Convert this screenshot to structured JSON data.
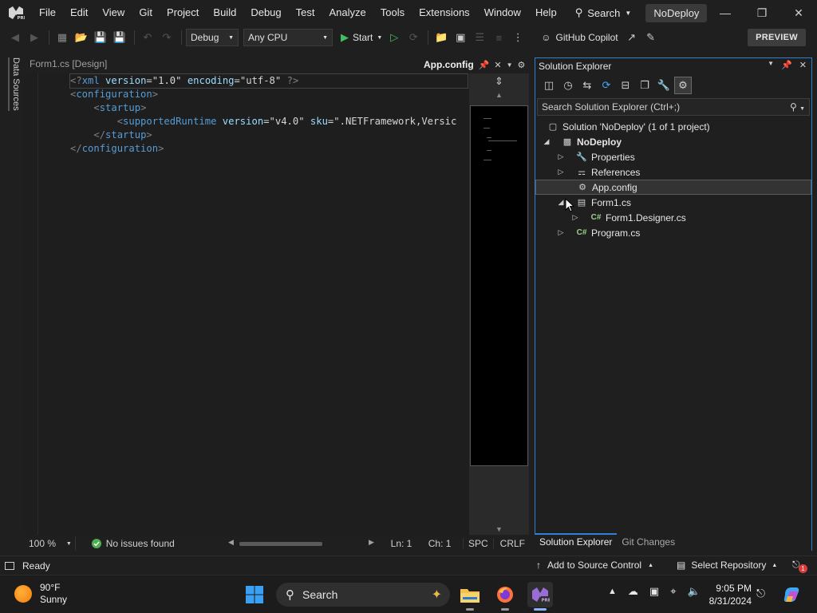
{
  "menubar": {
    "items": [
      "File",
      "Edit",
      "View",
      "Git",
      "Project",
      "Build",
      "Debug",
      "Test",
      "Analyze",
      "Tools",
      "Extensions",
      "Window",
      "Help"
    ],
    "search_label": "Search",
    "solution_badge": "NoDeploy"
  },
  "toolbar": {
    "config": "Debug",
    "platform": "Any CPU",
    "start_label": "Start",
    "copilot_label": "GitHub Copilot",
    "preview_label": "PREVIEW"
  },
  "left_strip": {
    "data_sources": "Data Sources"
  },
  "editor": {
    "tabs": {
      "design_tab": "Form1.cs [Design]",
      "active_tab": "App.config"
    },
    "code_lines": [
      {
        "parts": [
          [
            "punct",
            "<?"
          ],
          [
            "tag",
            "xml"
          ],
          [
            "sp",
            " "
          ],
          [
            "attr",
            "version"
          ],
          [
            "eq",
            "="
          ],
          [
            "q",
            "\""
          ],
          [
            "val",
            "1.0"
          ],
          [
            "q",
            "\""
          ],
          [
            "sp",
            " "
          ],
          [
            "attr",
            "encoding"
          ],
          [
            "eq",
            "="
          ],
          [
            "q",
            "\""
          ],
          [
            "val",
            "utf-8"
          ],
          [
            "q",
            "\""
          ],
          [
            "sp",
            " "
          ],
          [
            "punct",
            "?>"
          ]
        ]
      },
      {
        "parts": [
          [
            "punct",
            "<"
          ],
          [
            "tag",
            "configuration"
          ],
          [
            "punct",
            ">"
          ]
        ]
      },
      {
        "parts": [
          [
            "sp",
            "    "
          ],
          [
            "punct",
            "<"
          ],
          [
            "tag",
            "startup"
          ],
          [
            "punct",
            ">"
          ]
        ]
      },
      {
        "parts": [
          [
            "sp",
            "        "
          ],
          [
            "punct",
            "<"
          ],
          [
            "tag",
            "supportedRuntime"
          ],
          [
            "sp",
            " "
          ],
          [
            "attr",
            "version"
          ],
          [
            "eq",
            "="
          ],
          [
            "q",
            "\""
          ],
          [
            "val",
            "v4.0"
          ],
          [
            "q",
            "\""
          ],
          [
            "sp",
            " "
          ],
          [
            "attr",
            "sku"
          ],
          [
            "eq",
            "="
          ],
          [
            "q",
            "\""
          ],
          [
            "val",
            ".NETFramework,Versic"
          ]
        ]
      },
      {
        "parts": [
          [
            "sp",
            "    "
          ],
          [
            "punct",
            "</"
          ],
          [
            "tag",
            "startup"
          ],
          [
            "punct",
            ">"
          ]
        ]
      },
      {
        "parts": [
          [
            "punct",
            "</"
          ],
          [
            "tag",
            "configuration"
          ],
          [
            "punct",
            ">"
          ]
        ]
      }
    ],
    "status": {
      "zoom": "100 %",
      "issues": "No issues found",
      "line": "Ln: 1",
      "col": "Ch: 1",
      "whitespace": "SPC",
      "line_endings": "CRLF"
    }
  },
  "solution_explorer": {
    "title": "Solution Explorer",
    "search_placeholder": "Search Solution Explorer (Ctrl+;)",
    "tree": [
      {
        "label": "Solution 'NoDeploy' (1 of 1 project)",
        "depth": 0,
        "expander": "",
        "icon": "solution-icon",
        "bold": false,
        "selected": false
      },
      {
        "label": "NoDeploy",
        "depth": 1,
        "expander": "expanded",
        "icon": "csharp-project-icon",
        "bold": true,
        "selected": false
      },
      {
        "label": "Properties",
        "depth": 2,
        "expander": "collapsed",
        "icon": "wrench-icon",
        "bold": false,
        "selected": false
      },
      {
        "label": "References",
        "depth": 2,
        "expander": "collapsed",
        "icon": "references-icon",
        "bold": false,
        "selected": false
      },
      {
        "label": "App.config",
        "depth": 2,
        "expander": "",
        "icon": "config-file-icon",
        "bold": false,
        "selected": true
      },
      {
        "label": "Form1.cs",
        "depth": 2,
        "expander": "expanded",
        "icon": "form-icon",
        "bold": false,
        "selected": false
      },
      {
        "label": "Form1.Designer.cs",
        "depth": 3,
        "expander": "collapsed",
        "icon": "csharp-file-icon",
        "bold": false,
        "selected": false
      },
      {
        "label": "Program.cs",
        "depth": 2,
        "expander": "collapsed",
        "icon": "csharp-file-icon",
        "bold": false,
        "selected": false
      }
    ],
    "bottom_tabs": {
      "active": "Solution Explorer",
      "other": "Git Changes"
    }
  },
  "status_bar": {
    "ready": "Ready",
    "add_source": "Add to Source Control",
    "select_repo": "Select Repository",
    "notification_count": "1"
  },
  "taskbar": {
    "weather_temp": "90°F",
    "weather_desc": "Sunny",
    "search_label": "Search",
    "time": "9:05 PM",
    "date": "8/31/2024"
  },
  "colors": {
    "accent_blue": "#2f7fd3",
    "xml_tag": "#569cd6",
    "xml_attr": "#9cdcfe",
    "ok_green": "#4caf50"
  }
}
